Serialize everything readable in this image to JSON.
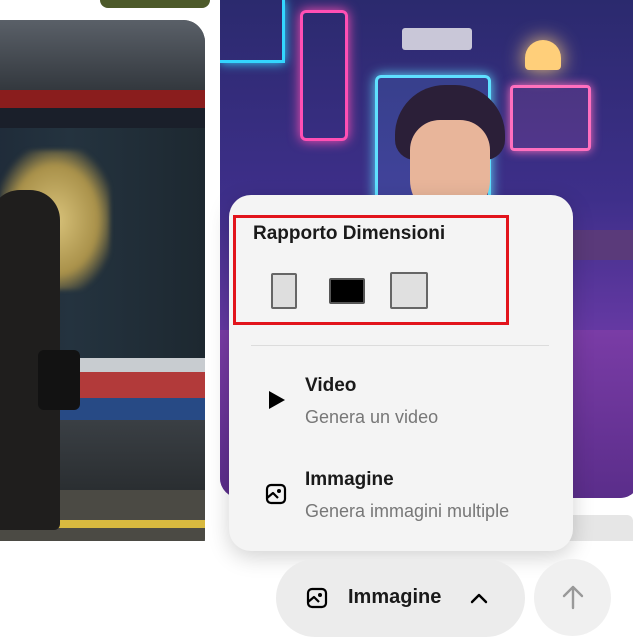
{
  "popup": {
    "aspect_ratio": {
      "title": "Rapporto Dimensioni",
      "options": [
        "portrait-ratio-icon",
        "landscape-ratio-icon",
        "square-ratio-icon"
      ],
      "selected": "landscape-ratio-icon"
    },
    "items": [
      {
        "icon": "play-icon",
        "title": "Video",
        "subtitle": "Genera un video"
      },
      {
        "icon": "image-icon",
        "title": "Immagine",
        "subtitle": "Genera immagini multiple"
      }
    ]
  },
  "composer": {
    "mode_label": "Immagine",
    "mode_icon": "image-icon",
    "chevron": "chevron-up-icon",
    "send_icon": "arrow-up-icon"
  },
  "colors": {
    "highlight": "#e2141c",
    "popup_bg": "#f4f4f4",
    "pill_bg": "#ececec"
  },
  "background_images": {
    "left_tile": "train-platform-photo",
    "right_tile": "neon-cafe-illustration"
  }
}
